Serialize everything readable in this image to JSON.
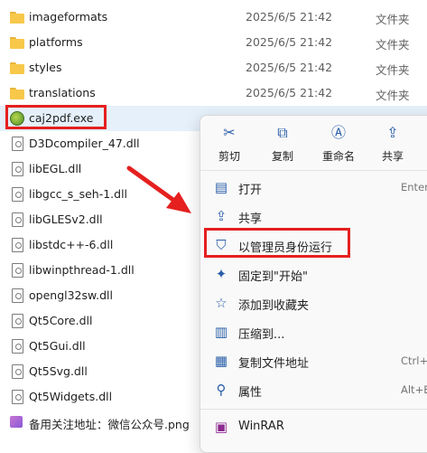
{
  "files": [
    {
      "name": "imageformats",
      "date": "2025/6/5 21:42",
      "type": "文件夹",
      "icon": "folder-icon"
    },
    {
      "name": "platforms",
      "date": "2025/6/5 21:42",
      "type": "文件夹",
      "icon": "folder-icon"
    },
    {
      "name": "styles",
      "date": "2025/6/5 21:42",
      "type": "文件夹",
      "icon": "folder-icon"
    },
    {
      "name": "translations",
      "date": "2025/6/5 21:42",
      "type": "文件夹",
      "icon": "folder-icon"
    },
    {
      "name": "caj2pdf.exe",
      "date": "",
      "type": "",
      "icon": "exe-icon"
    },
    {
      "name": "D3Dcompiler_47.dll",
      "date": "",
      "type": "",
      "icon": "dll-icon"
    },
    {
      "name": "libEGL.dll",
      "date": "",
      "type": "",
      "icon": "dll-icon"
    },
    {
      "name": "libgcc_s_seh-1.dll",
      "date": "",
      "type": "",
      "icon": "dll-icon"
    },
    {
      "name": "libGLESv2.dll",
      "date": "",
      "type": "",
      "icon": "dll-icon"
    },
    {
      "name": "libstdc++-6.dll",
      "date": "",
      "type": "",
      "icon": "dll-icon"
    },
    {
      "name": "libwinpthread-1.dll",
      "date": "",
      "type": "",
      "icon": "dll-icon"
    },
    {
      "name": "opengl32sw.dll",
      "date": "",
      "type": "",
      "icon": "dll-icon"
    },
    {
      "name": "Qt5Core.dll",
      "date": "",
      "type": "",
      "icon": "dll-icon"
    },
    {
      "name": "Qt5Gui.dll",
      "date": "",
      "type": "",
      "icon": "dll-icon"
    },
    {
      "name": "Qt5Svg.dll",
      "date": "",
      "type": "",
      "icon": "dll-icon"
    },
    {
      "name": "Qt5Widgets.dll",
      "date": "",
      "type": "",
      "icon": "dll-icon"
    },
    {
      "name": "备用关注地址：微信公众号.png",
      "date": "",
      "type": "",
      "icon": "png-icon"
    }
  ],
  "context_menu": {
    "quick_actions": [
      {
        "label": "剪切",
        "icon": "scissors-icon"
      },
      {
        "label": "复制",
        "icon": "copy-icon"
      },
      {
        "label": "重命名",
        "icon": "rename-icon"
      },
      {
        "label": "共享",
        "icon": "share-icon"
      }
    ],
    "items": [
      {
        "label": "打开",
        "shortcut": "Enter",
        "icon": "open-icon"
      },
      {
        "label": "共享",
        "shortcut": "",
        "icon": "share-icon"
      },
      {
        "label": "以管理员身份运行",
        "shortcut": "",
        "icon": "shield-icon"
      },
      {
        "label": "固定到\"开始\"",
        "shortcut": "",
        "icon": "pin-icon"
      },
      {
        "label": "添加到收藏夹",
        "shortcut": "",
        "icon": "star-icon"
      },
      {
        "label": "压缩到...",
        "shortcut": "",
        "icon": "zip-icon"
      },
      {
        "label": "复制文件地址",
        "shortcut": "Ctrl+",
        "icon": "copy-path-icon"
      },
      {
        "label": "属性",
        "shortcut": "Alt+E",
        "icon": "wrench-icon"
      },
      {
        "label": "WinRAR",
        "shortcut": "",
        "icon": "winrar-icon"
      }
    ]
  },
  "colors": {
    "highlight": "#e5201f",
    "accent": "#2a5ea8",
    "selection": "#e5f0fb"
  }
}
